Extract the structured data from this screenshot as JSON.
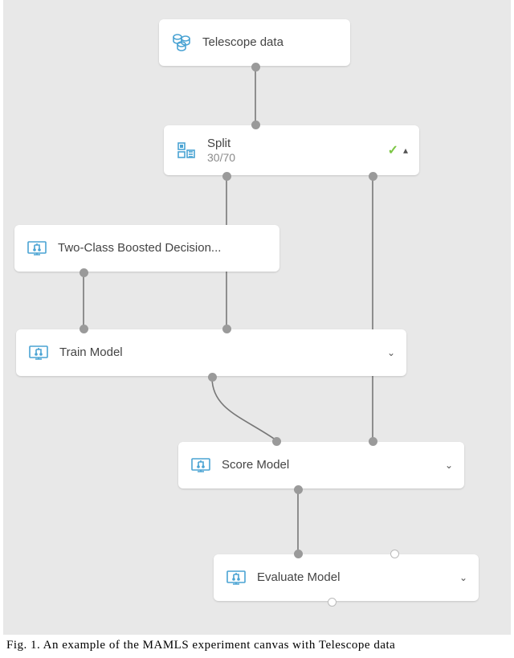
{
  "nodes": {
    "telescope": {
      "title": "Telescope data"
    },
    "split": {
      "title": "Split",
      "sub": "30/70"
    },
    "boosted": {
      "title": "Two-Class Boosted Decision..."
    },
    "train": {
      "title": "Train Model"
    },
    "score": {
      "title": "Score Model"
    },
    "evaluate": {
      "title": "Evaluate Model"
    }
  },
  "caption": "Fig. 1. An example of the MAMLS experiment canvas with Telescope data"
}
